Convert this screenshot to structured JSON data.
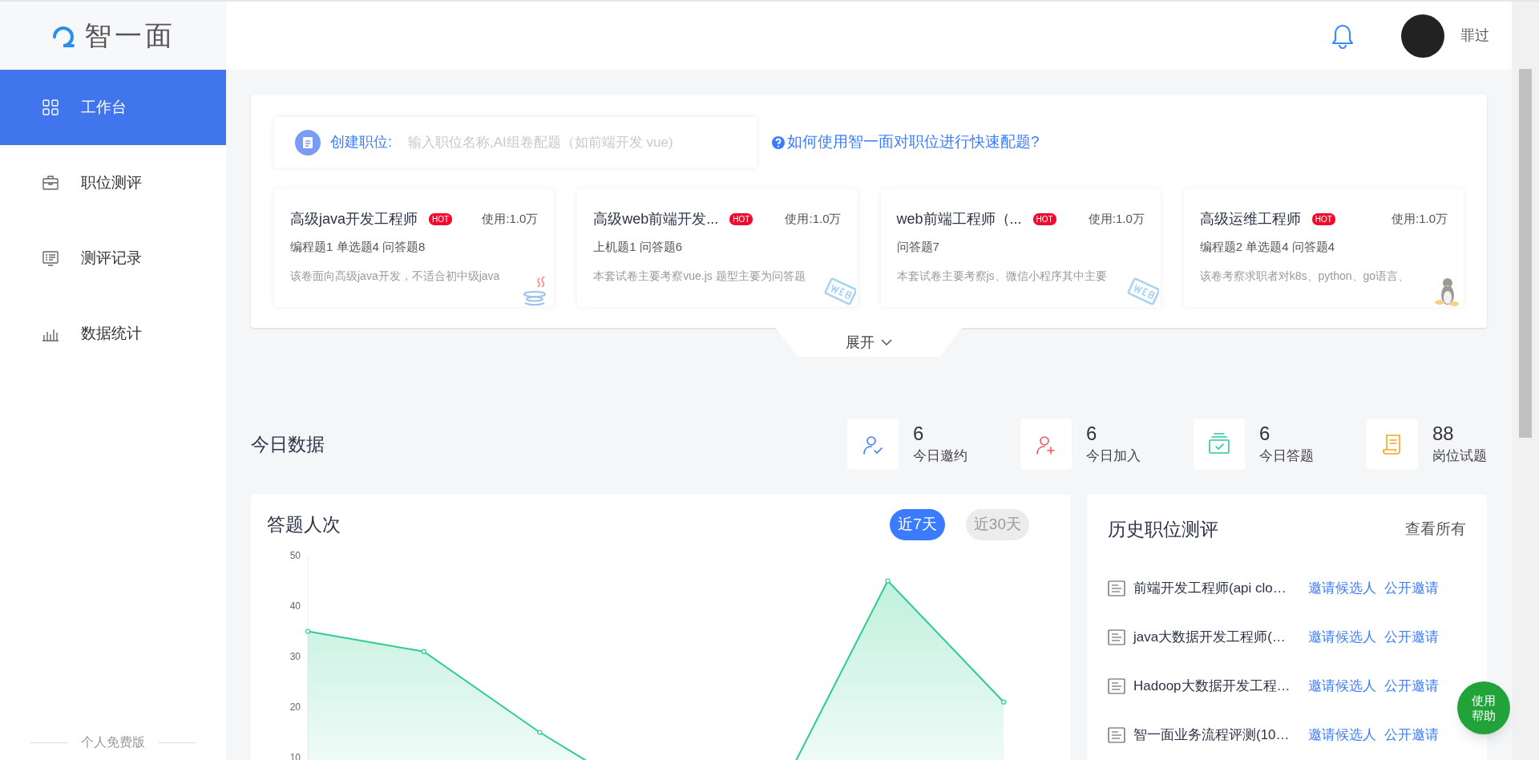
{
  "logo": {
    "text": "智一面"
  },
  "header": {
    "user_name": "罪过"
  },
  "sidebar": {
    "items": [
      {
        "label": "工作台",
        "kind": "grid",
        "selected": true
      },
      {
        "label": "职位测评",
        "kind": "briefcase",
        "selected": false
      },
      {
        "label": "测评记录",
        "kind": "list",
        "selected": false
      },
      {
        "label": "数据统计",
        "kind": "bars",
        "selected": false
      }
    ],
    "footer": "个人免费版"
  },
  "create_position": {
    "label": "创建职位:",
    "placeholder": "输入职位名称,AI组卷配题（如前端开发 vue)",
    "help_link": "如何使用智一面对职位进行快速配题?"
  },
  "templates": [
    {
      "title": "高级java开发工程师",
      "badge": "HOT",
      "usage": "使用:1.0万",
      "questions": "编程题1 单选题4 问答题8",
      "description": "该卷面向高级java开发，不适合初中级java",
      "kind": "java"
    },
    {
      "title": "高级web前端开发...",
      "badge": "HOT",
      "usage": "使用:1.0万",
      "questions": "上机题1 问答题6",
      "description": "本套试卷主要考察vue.js 题型主要为问答题",
      "kind": "web"
    },
    {
      "title": "web前端工程师（...",
      "badge": "HOT",
      "usage": "使用:1.0万",
      "questions": "问答题7",
      "description": "本套试卷主要考察js、微信小程序其中主要",
      "kind": "web"
    },
    {
      "title": "高级运维工程师",
      "badge": "HOT",
      "usage": "使用:1.0万",
      "questions": "编程题2 单选题4 问答题4",
      "description": "该卷考察求职者对k8s、python、go语言、",
      "kind": "linux"
    }
  ],
  "expand_label": "展开",
  "today": {
    "title": "今日数据",
    "stats": [
      {
        "value": "6",
        "label": "今日邀约",
        "kind": "invite"
      },
      {
        "value": "6",
        "label": "今日加入",
        "kind": "join"
      },
      {
        "value": "6",
        "label": "今日答题",
        "kind": "answer"
      },
      {
        "value": "88",
        "label": "岗位试题",
        "kind": "paper"
      }
    ]
  },
  "chart_panel": {
    "title": "答题人次",
    "ranges": [
      {
        "label": "近7天",
        "selected": true
      },
      {
        "label": "近30天",
        "selected": false
      }
    ],
    "chart_data": {
      "type": "area",
      "ylim": [
        0,
        50
      ],
      "yticks": [
        10,
        20,
        30,
        40,
        50
      ],
      "series": [
        {
          "color": "#2ecc8f",
          "values": [
            35,
            31,
            15,
            1,
            0,
            45,
            21
          ]
        }
      ]
    }
  },
  "history": {
    "title": "历史职位测评",
    "view_all": "查看所有",
    "rows": [
      {
        "title": "前端开发工程师(api clo…",
        "actions": [
          "邀请候选人",
          "公开邀请"
        ]
      },
      {
        "title": "java大数据开发工程师(…",
        "actions": [
          "邀请候选人",
          "公开邀请"
        ]
      },
      {
        "title": "Hadoop大数据开发工程…",
        "actions": [
          "邀请候选人",
          "公开邀请"
        ]
      },
      {
        "title": "智一面业务流程评测(10…",
        "actions": [
          "邀请候选人",
          "公开邀请"
        ]
      }
    ]
  },
  "help_button": {
    "label": "使用帮助"
  }
}
